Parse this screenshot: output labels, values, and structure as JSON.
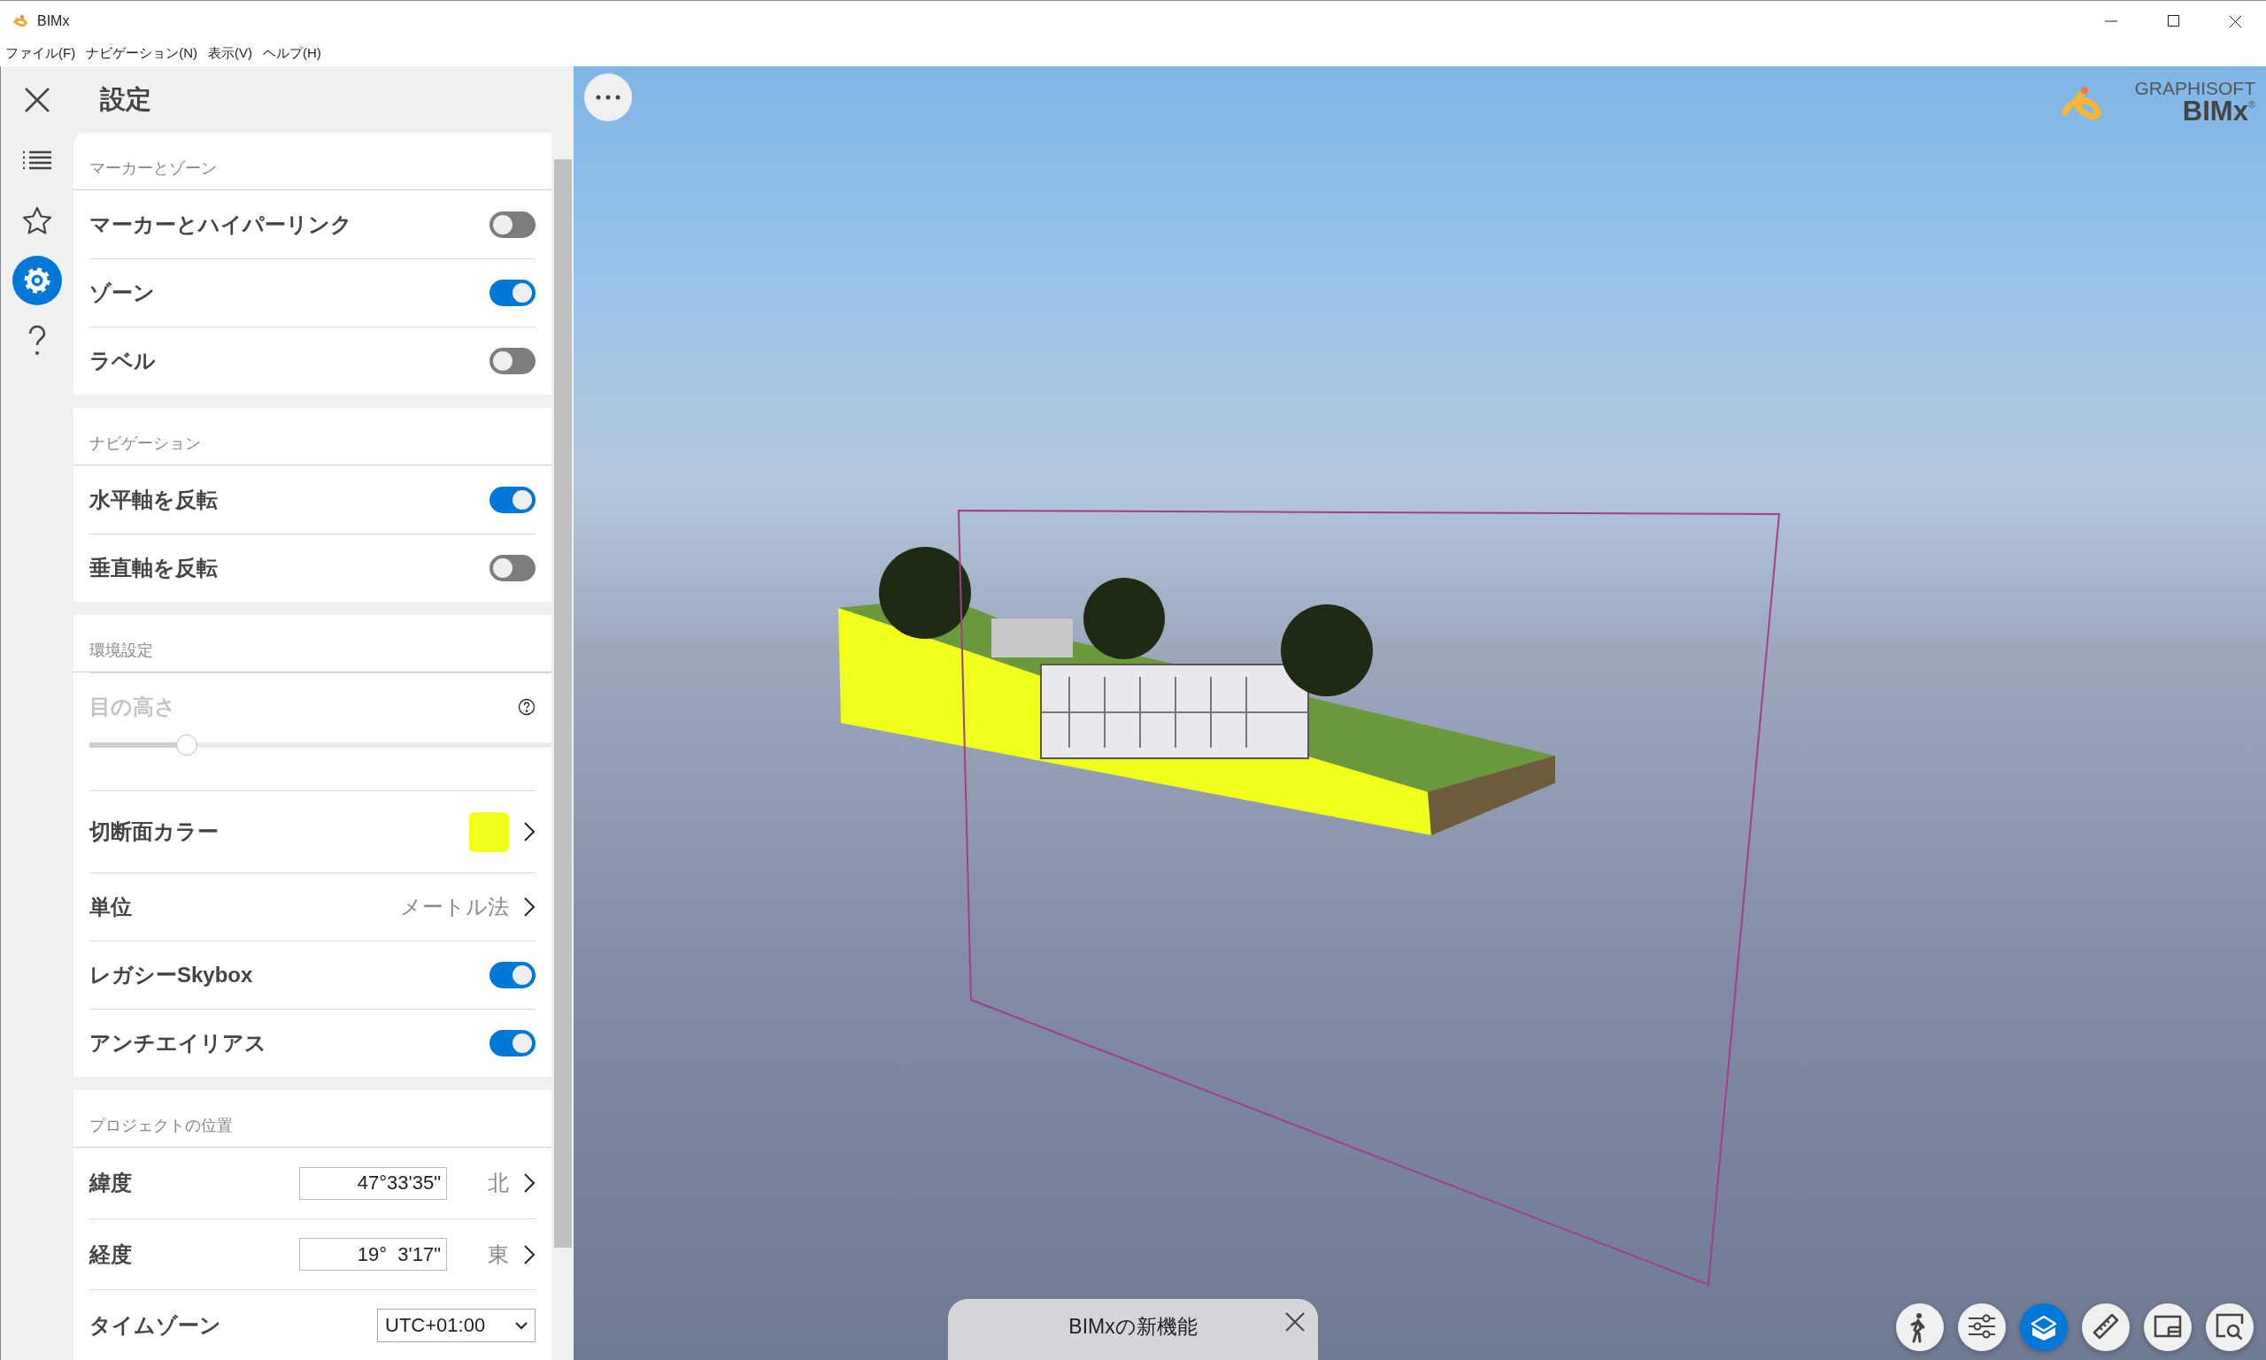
{
  "window": {
    "title": "BIMx"
  },
  "menu": [
    "ファイル(F)",
    "ナビゲーション(N)",
    "表示(V)",
    "ヘルプ(H)"
  ],
  "rail": [
    {
      "kind": "list",
      "selected": false
    },
    {
      "kind": "star",
      "selected": false
    },
    {
      "kind": "settings",
      "selected": true
    },
    {
      "kind": "help",
      "selected": false
    }
  ],
  "settings": {
    "title": "設定",
    "groups": [
      {
        "heading": "マーカーとゾーン",
        "rows": [
          {
            "kind": "toggle",
            "label": "マーカーとハイパーリンク",
            "on": false
          },
          {
            "kind": "toggle",
            "label": "ゾーン",
            "on": true
          },
          {
            "kind": "toggle",
            "label": "ラベル",
            "on": false
          }
        ]
      },
      {
        "heading": "ナビゲーション",
        "rows": [
          {
            "kind": "toggle",
            "label": "水平軸を反転",
            "on": true
          },
          {
            "kind": "toggle",
            "label": "垂直軸を反転",
            "on": false
          }
        ]
      },
      {
        "heading": "環境設定",
        "rows": [
          {
            "kind": "slider",
            "label": "目の高さ",
            "disabled": true,
            "level": 0.21
          },
          {
            "kind": "color",
            "label": "切断面カラー",
            "color": "#f2ff1a"
          },
          {
            "kind": "choice",
            "label": "単位",
            "value": "メートル法"
          },
          {
            "kind": "toggle",
            "label": "レガシーSkybox",
            "on": true
          },
          {
            "kind": "toggle",
            "label": "アンチエイリアス",
            "on": true
          }
        ]
      },
      {
        "heading": "プロジェクトの位置",
        "rows": [
          {
            "kind": "coordinate",
            "label": "緯度",
            "value": "47°33'35\"",
            "direction": "北"
          },
          {
            "kind": "coordinate",
            "label": "経度",
            "value": "19°  3'17\"",
            "direction": "東"
          },
          {
            "kind": "select",
            "label": "タイムゾーン",
            "value": "UTC+01:00"
          }
        ]
      }
    ]
  },
  "logo": {
    "brand": "GRAPHISOFT",
    "product": "BIMx",
    "mark": "®"
  },
  "toolbar": [
    {
      "kind": "walk",
      "selected": false
    },
    {
      "kind": "sliders",
      "selected": false
    },
    {
      "kind": "section-box",
      "selected": true
    },
    {
      "kind": "ruler",
      "selected": false
    },
    {
      "kind": "layout",
      "selected": false
    },
    {
      "kind": "zoom",
      "selected": false
    }
  ],
  "notification": {
    "text": "BIMxの新機能"
  }
}
